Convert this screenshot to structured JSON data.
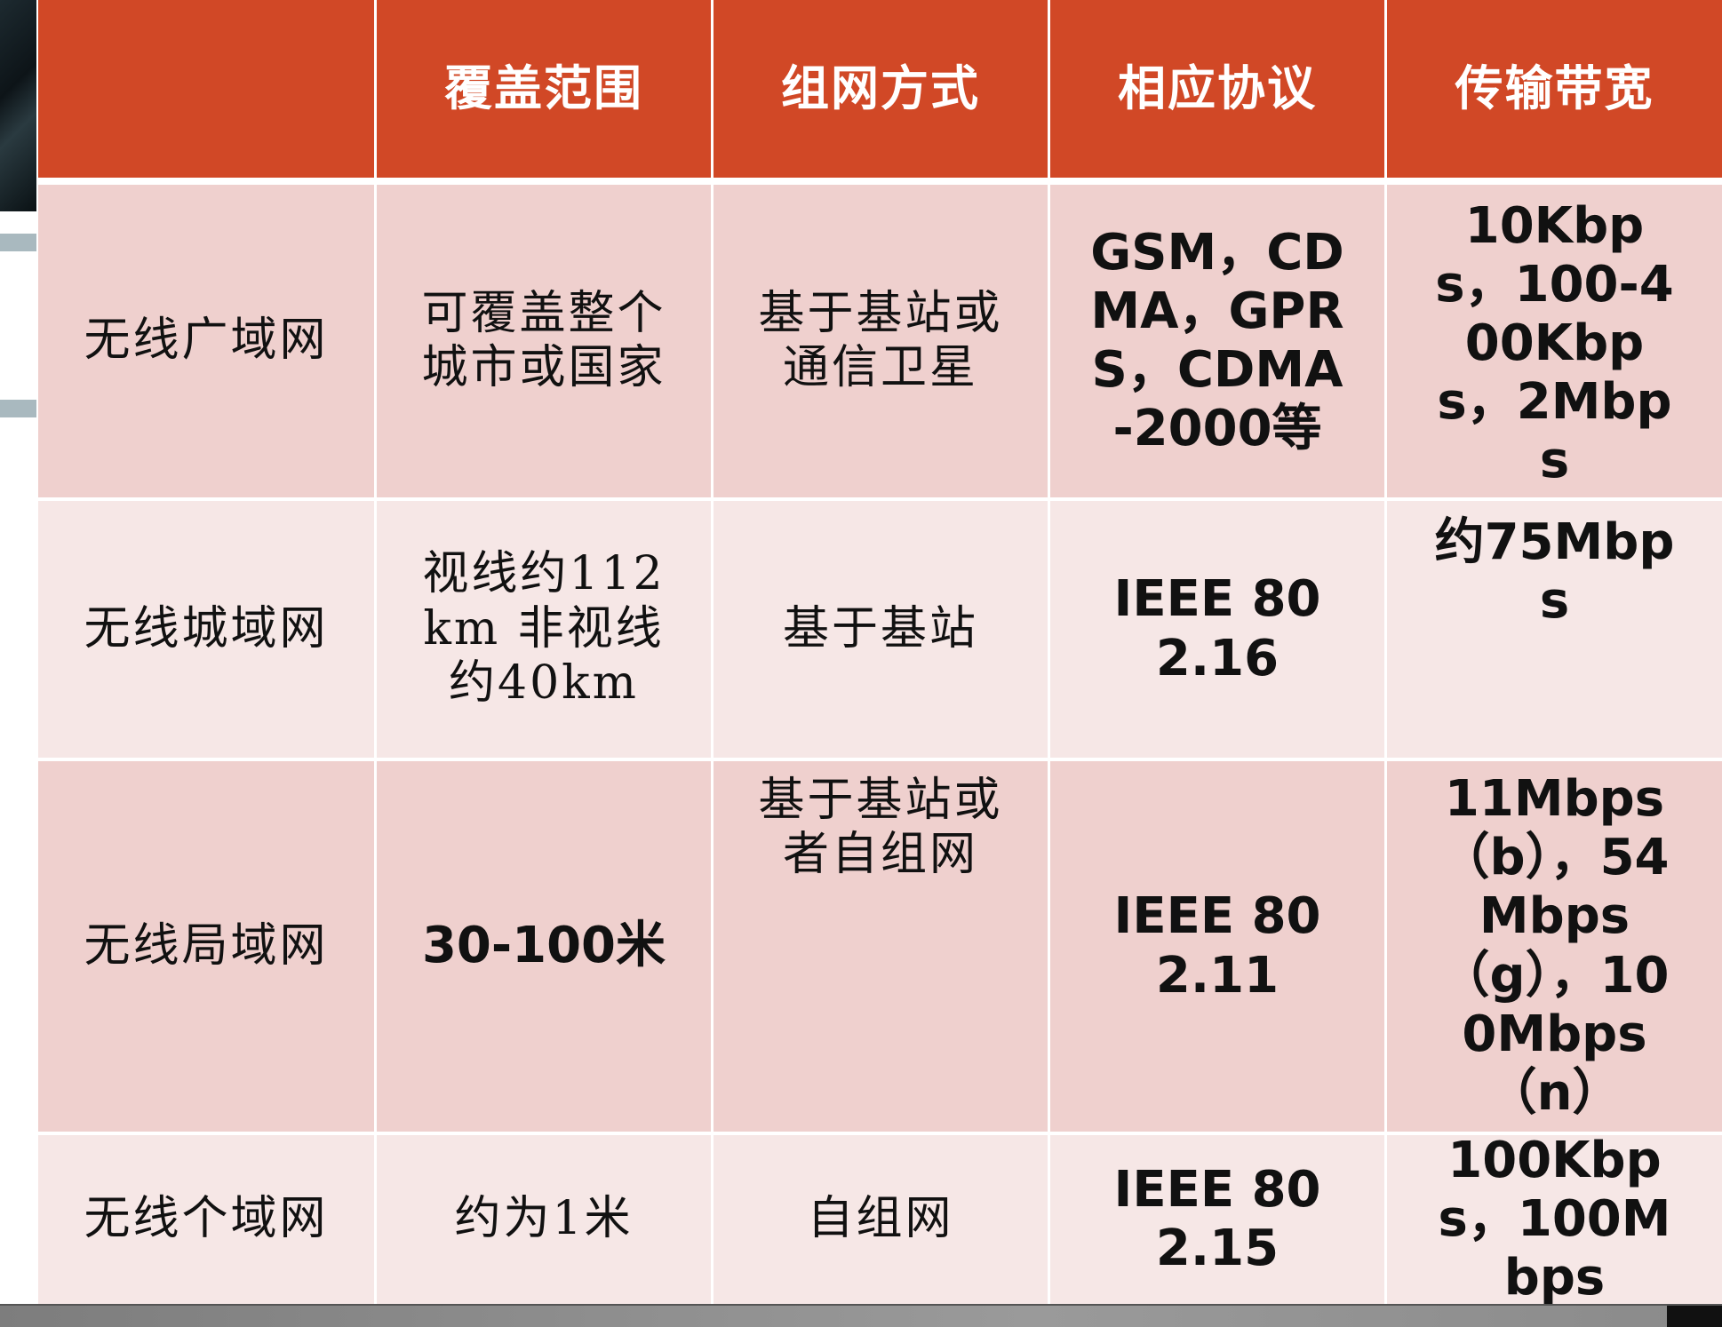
{
  "headers": [
    "",
    "覆盖范围",
    "组网方式",
    "相应协议",
    "传输带宽"
  ],
  "rows": [
    {
      "name": "无线广域网",
      "coverage": "可覆盖整个城市或国家",
      "networking": "基于基站或通信卫星",
      "protocol": "GSM，CDMA，GPRS，CDMA-2000等",
      "bandwidth": "10Kbps，100-400Kbps，2Mbps"
    },
    {
      "name": "无线城域网",
      "coverage": "视线约112km 非视线约40km",
      "networking": "基于基站",
      "protocol": "IEEE 802.16",
      "bandwidth": "约75Mbps"
    },
    {
      "name": "无线局域网",
      "coverage": "30-100米",
      "networking": "基于基站或者自组网",
      "protocol": "IEEE 802.11",
      "bandwidth": "11Mbps（b），54Mbps（g），100Mbps（n）"
    },
    {
      "name": "无线个域网",
      "coverage": "约为1米",
      "networking": "自组网",
      "protocol": "IEEE 802.15",
      "bandwidth": "100Kbps，100Mbps"
    }
  ],
  "colors": {
    "header": "#d14826",
    "row_odd": "#efd0ce",
    "row_even": "#f6e7e6"
  }
}
